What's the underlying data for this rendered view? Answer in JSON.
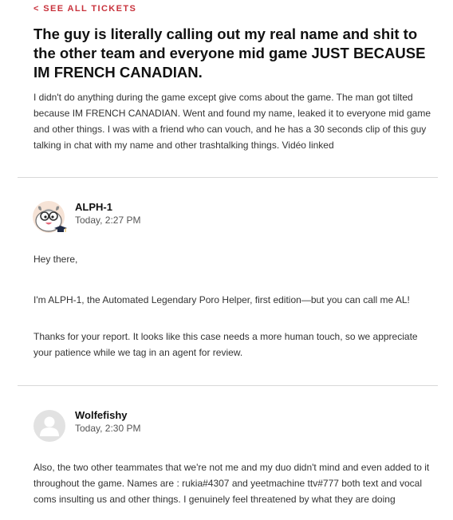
{
  "nav": {
    "back_label": "< SEE ALL TICKETS"
  },
  "ticket": {
    "title": "The guy is literally calling out my real name and shit to the other team and everyone mid game JUST BECAUSE IM FRENCH CANADIAN.",
    "body": "I didn't do anything during the game except give coms about the game. The man got tilted because IM FRENCH CANADIAN. Went and found my name, leaked it to everyone mid game and other things. I was with a friend who can vouch, and he has a 30 seconds clip of this guy talking in chat with my name and other trashtalking things. Vidéo linked"
  },
  "comments": [
    {
      "author": "ALPH-1",
      "time": "Today, 2:27 PM",
      "avatar_icon": "poro-bot-avatar-icon",
      "paragraphs": [
        "Hey there,",
        "I'm ALPH-1, the Automated Legendary Poro Helper, first edition—but you can call me AL!",
        "Thanks for your report. It looks like this case needs a more human touch, so we appreciate your patience while we tag in an agent for review."
      ]
    },
    {
      "author": "Wolfefishy",
      "time": "Today, 2:30 PM",
      "avatar_icon": "default-user-avatar-icon",
      "paragraphs": [
        "Also, the two other teammates that we're not me and my duo didn't mind and even added to it throughout the game. Names are : rukia#4307 and yeetmachine ttv#777 both text and vocal coms insulting us and other things. I genuinely feel threatened by what they are doing"
      ]
    }
  ],
  "colors": {
    "accent": "#c8323c",
    "divider": "#d8d8d8",
    "text": "#333333",
    "heading": "#111111",
    "avatar_placeholder": "#e2e2e2"
  }
}
